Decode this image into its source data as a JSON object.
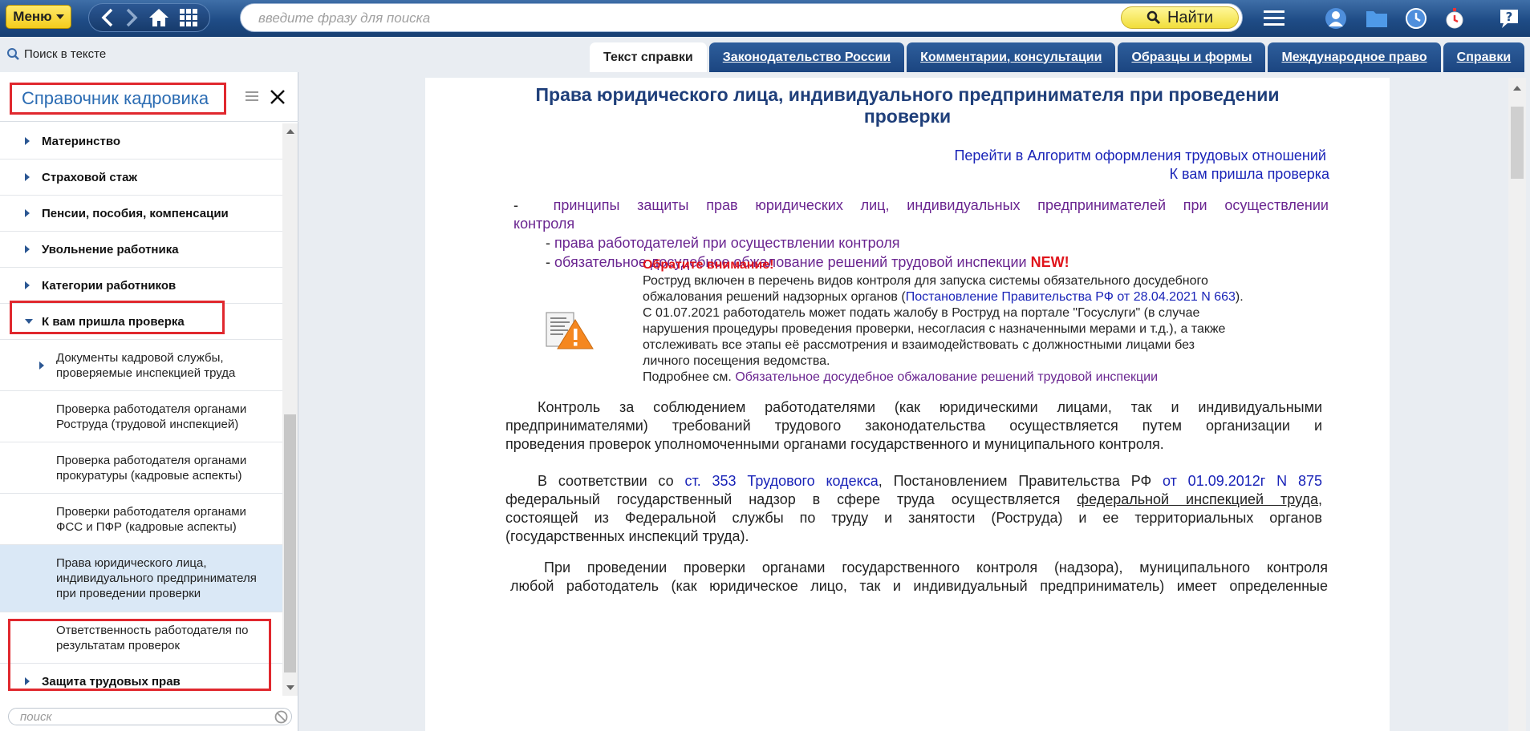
{
  "topbar": {
    "menu_label": "Меню",
    "search_placeholder": "введите фразу для поиска",
    "find_label": "Найти"
  },
  "toolbar": {
    "find_in_text": "Поиск в тексте"
  },
  "tabs": [
    {
      "label": "Текст справки"
    },
    {
      "label": "Законодательство России"
    },
    {
      "label": "Комментарии, консультации"
    },
    {
      "label": "Образцы и формы"
    },
    {
      "label": "Международное право"
    },
    {
      "label": "Справки"
    }
  ],
  "panel": {
    "title": "Справочник кадровика",
    "filter_placeholder": "поиск"
  },
  "tree": [
    {
      "label": "Материнство"
    },
    {
      "label": "Страховой стаж"
    },
    {
      "label": "Пенсии, пособия, компенсации"
    },
    {
      "label": "Увольнение работника"
    },
    {
      "label": "Категории работников"
    },
    {
      "label": "К вам пришла проверка"
    },
    {
      "label1": "Документы кадровой службы,",
      "label2": "проверяемые инспекцией труда"
    },
    {
      "label1": "Проверка работодателя органами",
      "label2": "Роструда (трудовой инспекцией)"
    },
    {
      "label1": "Проверка работодателя органами",
      "label2": "прокуратуры (кадровые аспекты)"
    },
    {
      "label1": "Проверки работодателя органами",
      "label2": "ФСС и ПФР (кадровые аспекты)"
    },
    {
      "label1": "Права юридического лица,",
      "label2": "индивидуального предпринимателя",
      "label3": "при проведении проверки"
    },
    {
      "label1": "Ответственность работодателя по",
      "label2": "результатам проверок"
    },
    {
      "label": "Защита трудовых прав"
    }
  ],
  "doc": {
    "title1": "Права юридического лица, индивидуального предпринимателя при проведении",
    "title2": "проверки",
    "link_algorithm": "Перейти в Алгоритм оформления трудовых отношений",
    "link_check": "К вам пришла проверка",
    "dash": "-",
    "b1_l1": "принципы защиты прав юридических лиц, индивидуальных предпринимателей при осуществлении",
    "b1_l2": "контроля",
    "b2": "права работодателей при осуществлении контроля",
    "b3": "обязательное досудебное обжалование решений трудовой инспекции",
    "new_badge": "NEW!",
    "notice": {
      "heading": "Обратите внимание!",
      "l1": "Роструд включен в перечень видов контроля для запуска системы обязательного досудебного",
      "l2_a": "обжалования решений надзорных органов (",
      "l2_link": "Постановление Правительства РФ от 28.04.2021 N 663",
      "l2_b": ").",
      "l3": "С 01.07.2021 работодатель может подать жалобу в Роструд на портале \"Госуслуги\" (в случае",
      "l4": "нарушения процедуры проведения проверки, несогласия с назначенными мерами и т.д.), а также",
      "l5": "отслеживать все этапы её рассмотрения и взаимодействовать с должностными лицами без",
      "l6": "личного посещения ведомства.",
      "l7_a": "Подробнее см. ",
      "l7_link": "Обязательное досудебное обжалование решений трудовой инспекции"
    },
    "p1_l1": "Контроль за соблюдением работодателями (как юридическими лицами, так и индивидуальными",
    "p1_l2": "предпринимателями) требований трудового законодательства осуществляется путем организации и",
    "p1_l3": "проведения проверок уполномоченными органами государственного и муниципального контроля.",
    "p2_a": "В соответствии со ",
    "p2_link1": "ст. 353 Трудового кодекса",
    "p2_b": ", Постановлением Правительства РФ ",
    "p2_link2": "от 01.09.2012г N 875",
    "p2_l2_a": "федеральный государственный надзор в сфере труда осуществляется ",
    "p2_l2_u": "федеральной инспекцией труда",
    "p2_l2_b": ",",
    "p2_l3": "состоящей из Федеральной службы по труду и занятости (Роструда) и ее территориальных органов",
    "p2_l4": "(государственных инспекций труда).",
    "p3_l1": "При проведении проверки органами государственного контроля (надзора), муниципального контроля",
    "p3_l2": "любой работодатель (как юридическое лицо, так и индивидуальный предприниматель) имеет определенные"
  },
  "colors": {
    "highlight_box": "#e0282e",
    "link": "#1a24b8",
    "visited_link": "#6a2590",
    "title": "#1f3f7a"
  }
}
